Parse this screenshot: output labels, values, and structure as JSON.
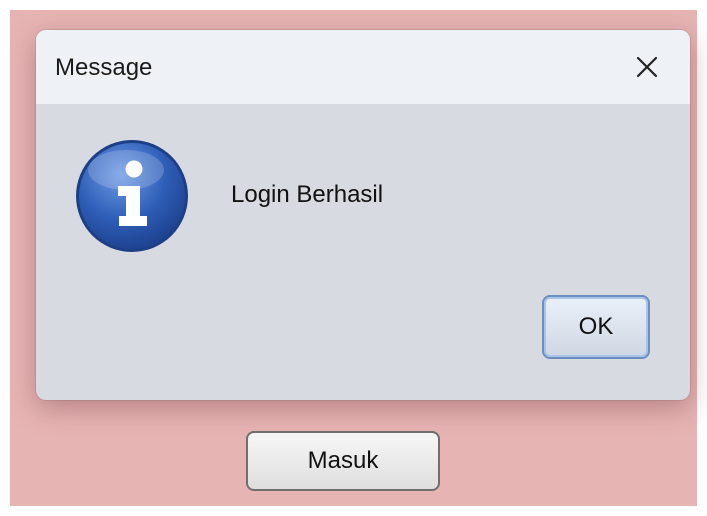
{
  "dialog": {
    "title": "Message",
    "message": "Login Berhasil",
    "ok_label": "OK",
    "close_icon": "close-icon",
    "info_icon": "information-icon"
  },
  "background_window": {
    "button_label": "Masuk"
  },
  "colors": {
    "backdrop": "#e7b4b4",
    "dialog_body": "#d8dae1",
    "titlebar": "#eef2f7",
    "ok_border": "#6b8fbf",
    "info_icon_blue": "#2f5fb8"
  }
}
